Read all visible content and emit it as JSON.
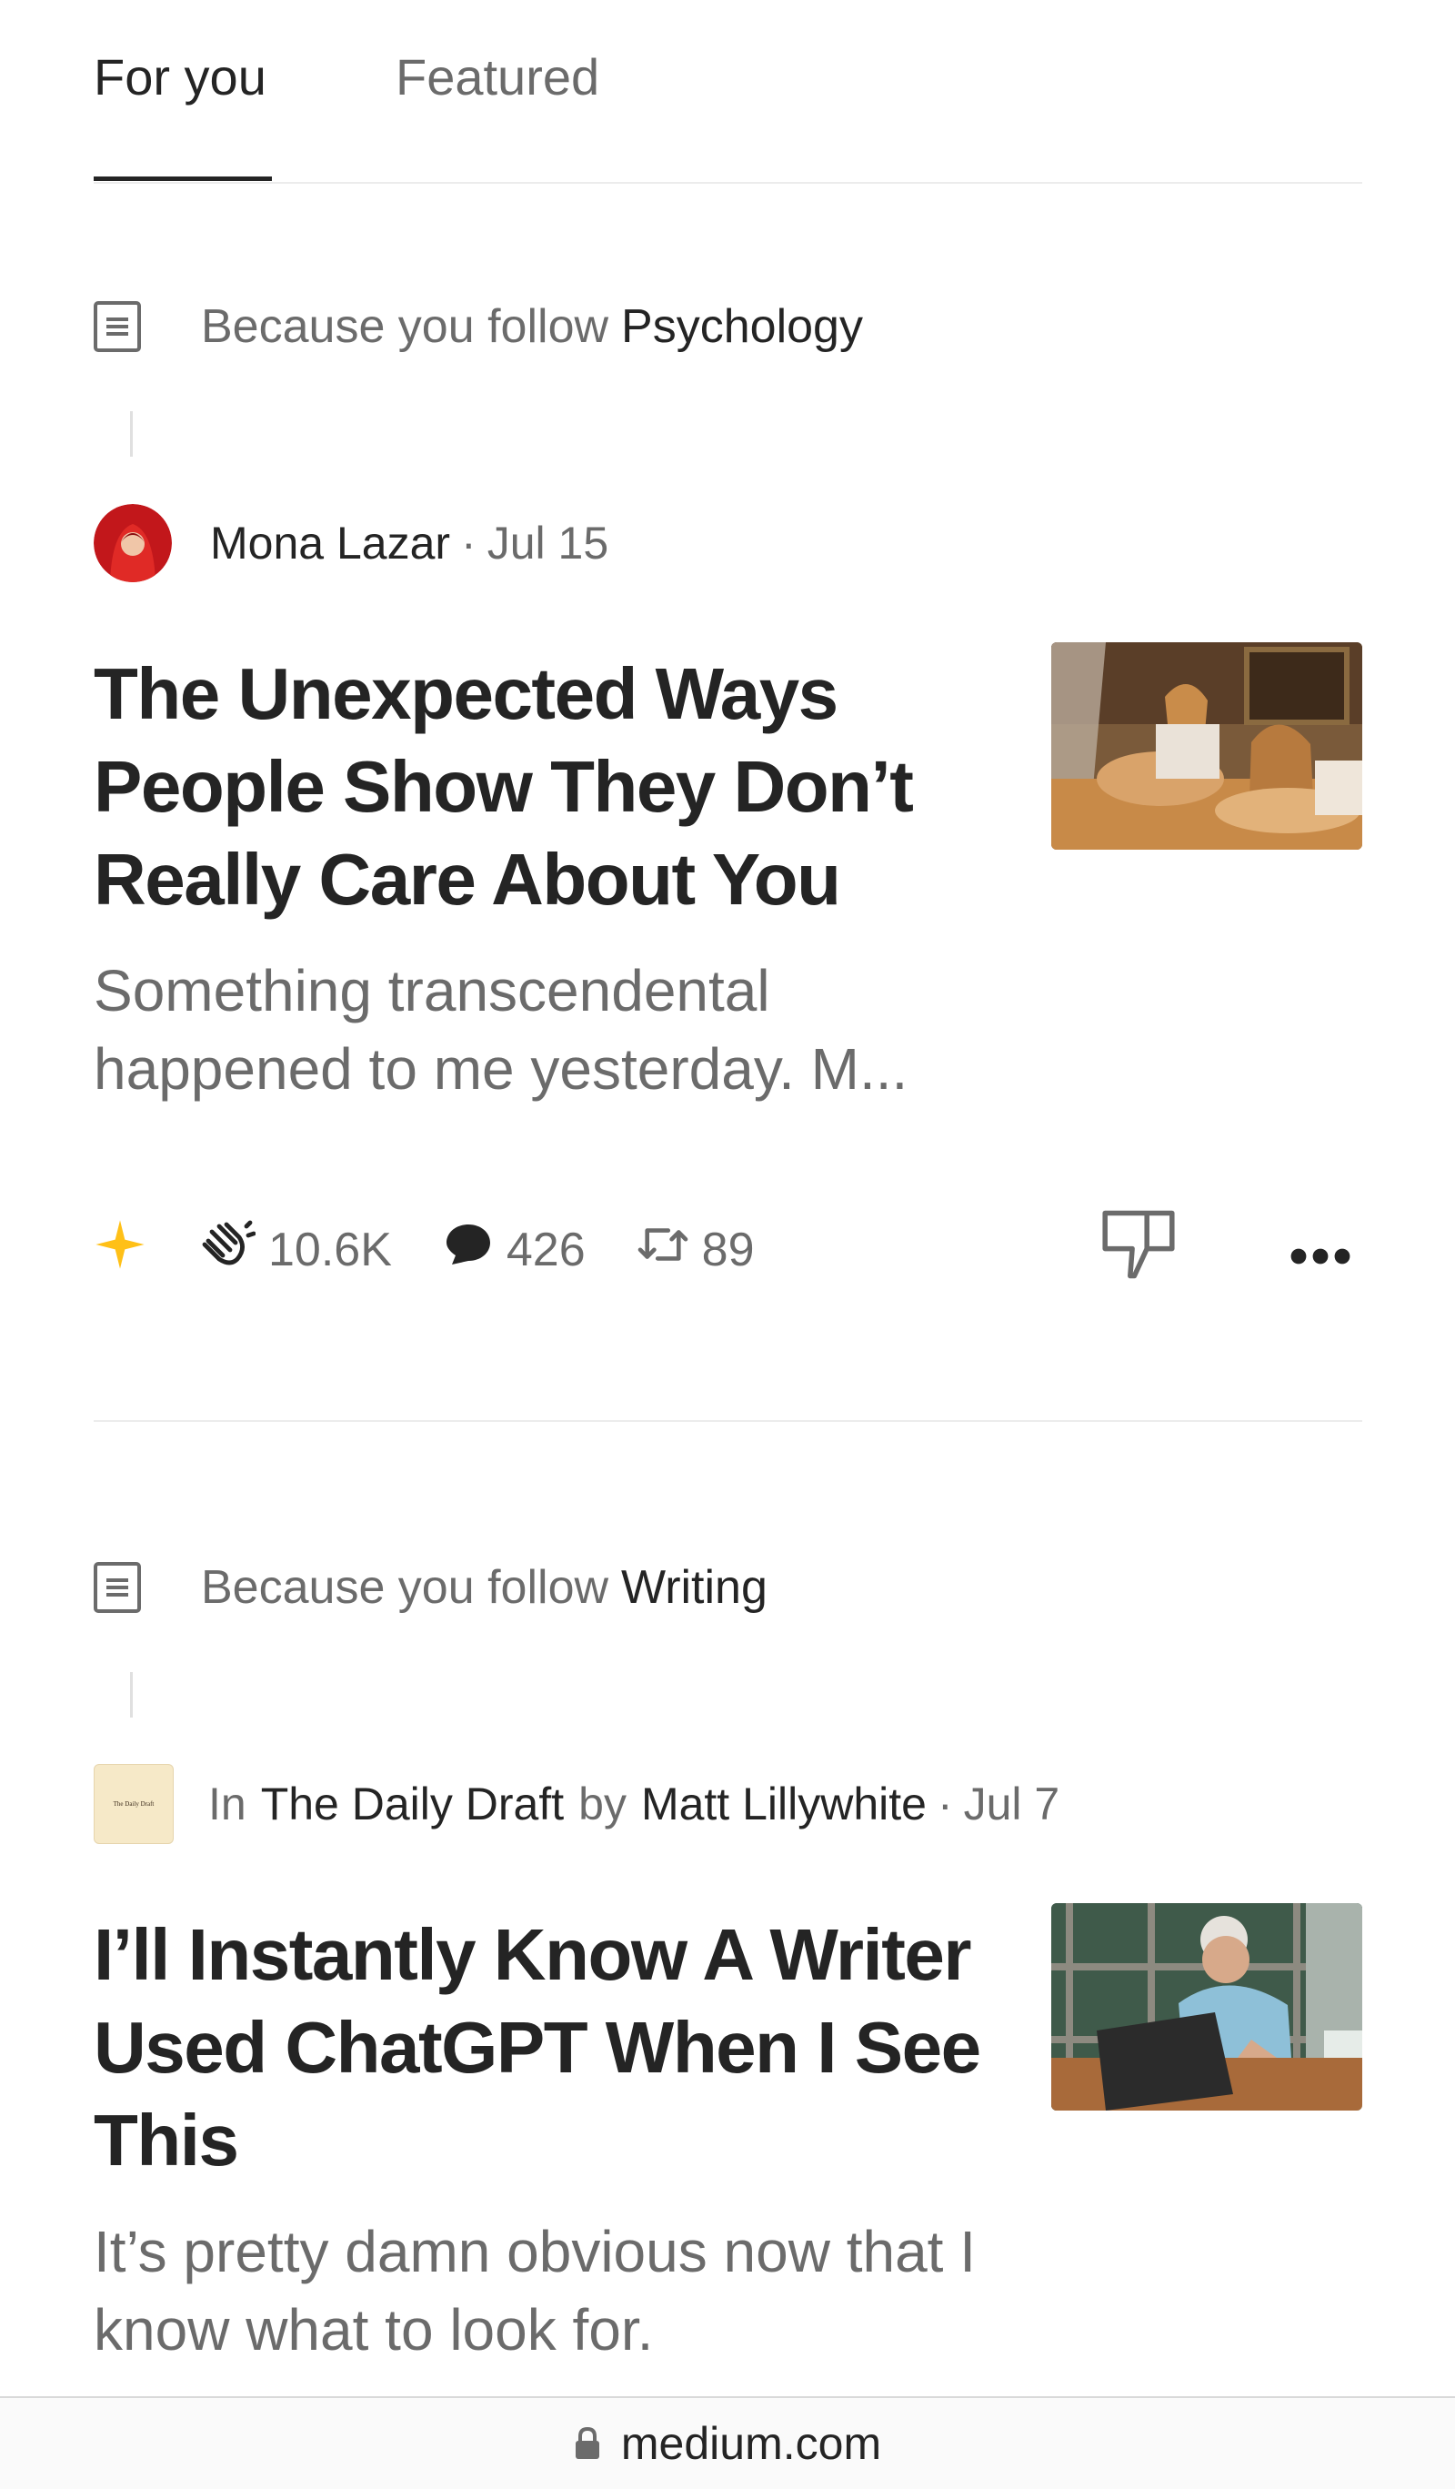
{
  "tabs": [
    {
      "label": "For you"
    },
    {
      "label": "Featured"
    }
  ],
  "articles": [
    {
      "reason_prefix": "Because you follow",
      "reason_topic": "Psychology",
      "author": "Mona Lazar",
      "date": "Jul 15",
      "title": "The Unexpected Ways People Show They Don’t Really Care About You",
      "subtitle": "Something transcendental happened to me yesterday. M...",
      "claps": "10.6K",
      "responses": "426",
      "reposts": "89",
      "icons": [
        "document-icon",
        "star-icon",
        "clap-icon",
        "comment-icon",
        "repost-icon",
        "dislike-icon",
        "more-icon"
      ]
    },
    {
      "reason_prefix": "Because you follow",
      "reason_topic": "Writing",
      "in_label": "In",
      "publication": "The Daily Draft",
      "by_label": "by",
      "author": "Matt Lillywhite",
      "date": "Jul 7",
      "pub_logo_text": "The Daily Draft",
      "title": "I’ll Instantly Know A Writer Used ChatGPT When I See This",
      "subtitle": "It’s pretty damn obvious now that I know what to look for."
    }
  ],
  "footer": {
    "domain": "medium.com"
  },
  "colors": {
    "accent_star": "#FFC017",
    "text_primary": "#242424",
    "text_muted": "#6b6b6b"
  }
}
